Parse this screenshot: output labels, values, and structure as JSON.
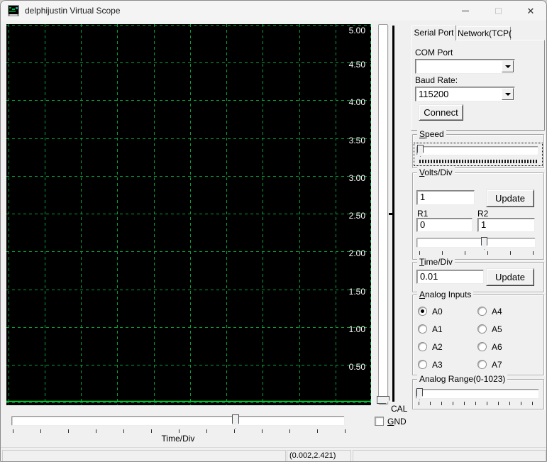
{
  "window": {
    "title": "delphijustin Virtual Scope"
  },
  "icons": {
    "app": "oscilloscope-app-icon",
    "minimize": "minimize-icon",
    "maximize": "maximize-icon",
    "close": "close-icon",
    "combo_arrow": "chevron-down-icon"
  },
  "tabs": [
    {
      "label": "Serial Port",
      "active": true
    },
    {
      "label": "Network(TCP(",
      "active": false
    }
  ],
  "serial": {
    "com_port_label": "COM Port",
    "com_port_value": "",
    "baud_rate_label": "Baud Rate:",
    "baud_rate_value": "115200",
    "connect_label": "Connect"
  },
  "speed": {
    "label": "Speed"
  },
  "volts_div": {
    "label": "Volts/Div",
    "value": "1",
    "update_label": "Update",
    "r1_label": "R1",
    "r1_value": "0",
    "r2_label": "R2",
    "r2_value": "1"
  },
  "time_div": {
    "label": "Time/Div",
    "value": "0.01",
    "update_label": "Update"
  },
  "analog_inputs": {
    "label": "Analog Inputs",
    "options": [
      "A0",
      "A1",
      "A2",
      "A3",
      "A4",
      "A5",
      "A6",
      "A7"
    ],
    "selected": "A0"
  },
  "analog_range": {
    "label": "Analog Range(0-1023)"
  },
  "scope": {
    "y_axis_labels": [
      "5.00",
      "4.50",
      "4.00",
      "3.50",
      "3.00",
      "2.50",
      "2.00",
      "1.50",
      "1.00",
      "0.50"
    ]
  },
  "bottom": {
    "time_div_slider_label": "Time/Div",
    "cal_label": "CAL",
    "gnd_label": "GND"
  },
  "status_bar": {
    "coordinates": "(0.002,2.421)"
  }
}
